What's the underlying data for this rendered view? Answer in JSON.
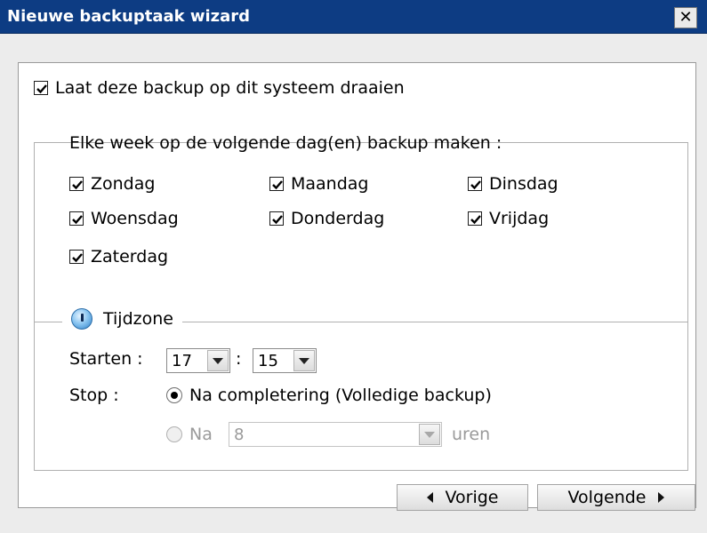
{
  "window": {
    "title": "Nieuwe backuptaak wizard",
    "close_glyph": "✕"
  },
  "run_on_system": {
    "checked": true,
    "label": "Laat deze backup op dit systeem draaien"
  },
  "schedule": {
    "heading": "Elke week op de volgende dag(en) backup maken :",
    "days": [
      {
        "label": "Zondag",
        "checked": true
      },
      {
        "label": "Maandag",
        "checked": true
      },
      {
        "label": "Dinsdag",
        "checked": true
      },
      {
        "label": "Woensdag",
        "checked": true
      },
      {
        "label": "Donderdag",
        "checked": true
      },
      {
        "label": "Vrijdag",
        "checked": true
      },
      {
        "label": "Zaterdag",
        "checked": true
      }
    ]
  },
  "timezone": {
    "label": "Tijdzone",
    "icon": "clock-icon",
    "start_label": "Starten :",
    "start_hour": "17",
    "time_separator": ":",
    "start_minute": "15",
    "stop_label": "Stop :",
    "stop_option_complete": "Na completering (Volledige backup)",
    "stop_option_after_prefix": "Na",
    "stop_after_hours": "8",
    "stop_after_unit": "uren",
    "selected_stop_option": "complete"
  },
  "buttons": {
    "back": "Vorige",
    "next": "Volgende"
  },
  "colors": {
    "titlebar": "#0d3c83",
    "background": "#ececec",
    "panel": "#ffffff"
  }
}
